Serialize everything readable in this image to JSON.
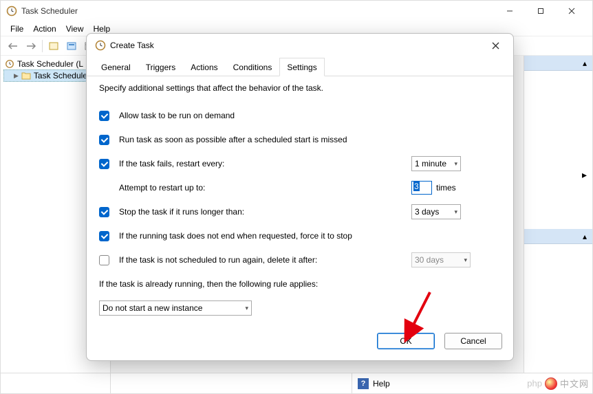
{
  "window": {
    "title": "Task Scheduler",
    "menu": [
      "File",
      "Action",
      "View",
      "Help"
    ]
  },
  "tree": {
    "root": "Task Scheduler (L",
    "child": "Task Schedule"
  },
  "status": {
    "help": "Help"
  },
  "dialog": {
    "title": "Create Task",
    "tabs": [
      "General",
      "Triggers",
      "Actions",
      "Conditions",
      "Settings"
    ],
    "active_tab": "Settings",
    "description": "Specify additional settings that affect the behavior of the task.",
    "opt_allow_demand": "Allow task to be run on demand",
    "opt_run_asap": "Run task as soon as possible after a scheduled start is missed",
    "opt_restart": "If the task fails, restart every:",
    "restart_interval": "1 minute",
    "opt_attempt_label": "Attempt to restart up to:",
    "attempt_value": "3",
    "attempt_suffix": "times",
    "opt_stop_longer": "Stop the task if it runs longer than:",
    "stop_duration": "3 days",
    "opt_force_stop": "If the running task does not end when requested, force it to stop",
    "opt_delete_after": "If the task is not scheduled to run again, delete it after:",
    "delete_duration": "30 days",
    "rule_label": "If the task is already running, then the following rule applies:",
    "rule_value": "Do not start a new instance",
    "ok": "OK",
    "cancel": "Cancel"
  },
  "watermark": "中文网"
}
